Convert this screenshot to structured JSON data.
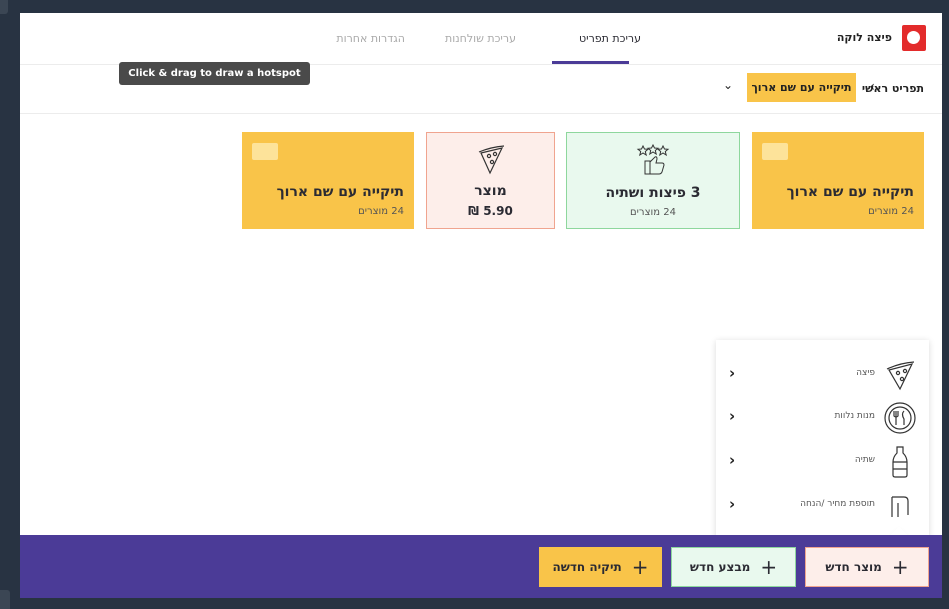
{
  "header": {
    "brand": "פיצה לוקה",
    "tabs": [
      "עריכת תפריט",
      "עריכת שולחנות",
      "הגדרות אחרות"
    ]
  },
  "breadcrumb": {
    "root": "תפריט ראשי",
    "separator": "›",
    "current": "תיקייה עם שם ארוך",
    "dropdown": "⌄"
  },
  "tooltip": "Click & drag to draw a hotspot",
  "cards": [
    {
      "type": "folder",
      "title": "תיקייה עם שם ארוך",
      "sub": "24 מוצרים"
    },
    {
      "type": "bundle",
      "title": "3 פיצות ושתיה",
      "sub": "24 מוצרים",
      "icon": "thumbs-up-stars-icon"
    },
    {
      "type": "product",
      "title": "מוצר",
      "price": "5.90 ₪",
      "icon": "pizza-slice-icon"
    },
    {
      "type": "folder",
      "title": "תיקייה עם שם ארוך",
      "sub": "24 מוצרים"
    }
  ],
  "menu": {
    "items": [
      {
        "label": "פיצה",
        "icon": "pizza-slice-icon"
      },
      {
        "label": "מנות נלוות",
        "icon": "plate-cutlery-icon"
      },
      {
        "label": "שתיה",
        "icon": "bottle-icon"
      },
      {
        "label": "תוספת מחיר /הנחה",
        "icon": "price-tag-icon"
      }
    ]
  },
  "actions": {
    "new_product": "מוצר חדש",
    "new_deal": "מבצע חדש",
    "new_folder": "תיקיה חדשה",
    "plus": "+"
  },
  "colors": {
    "accent": "#4b3b97",
    "folder": "#f9c449",
    "bundle_bg": "#e9f9ee",
    "product_bg": "#fdeeea",
    "brand_red": "#e32b2b"
  }
}
